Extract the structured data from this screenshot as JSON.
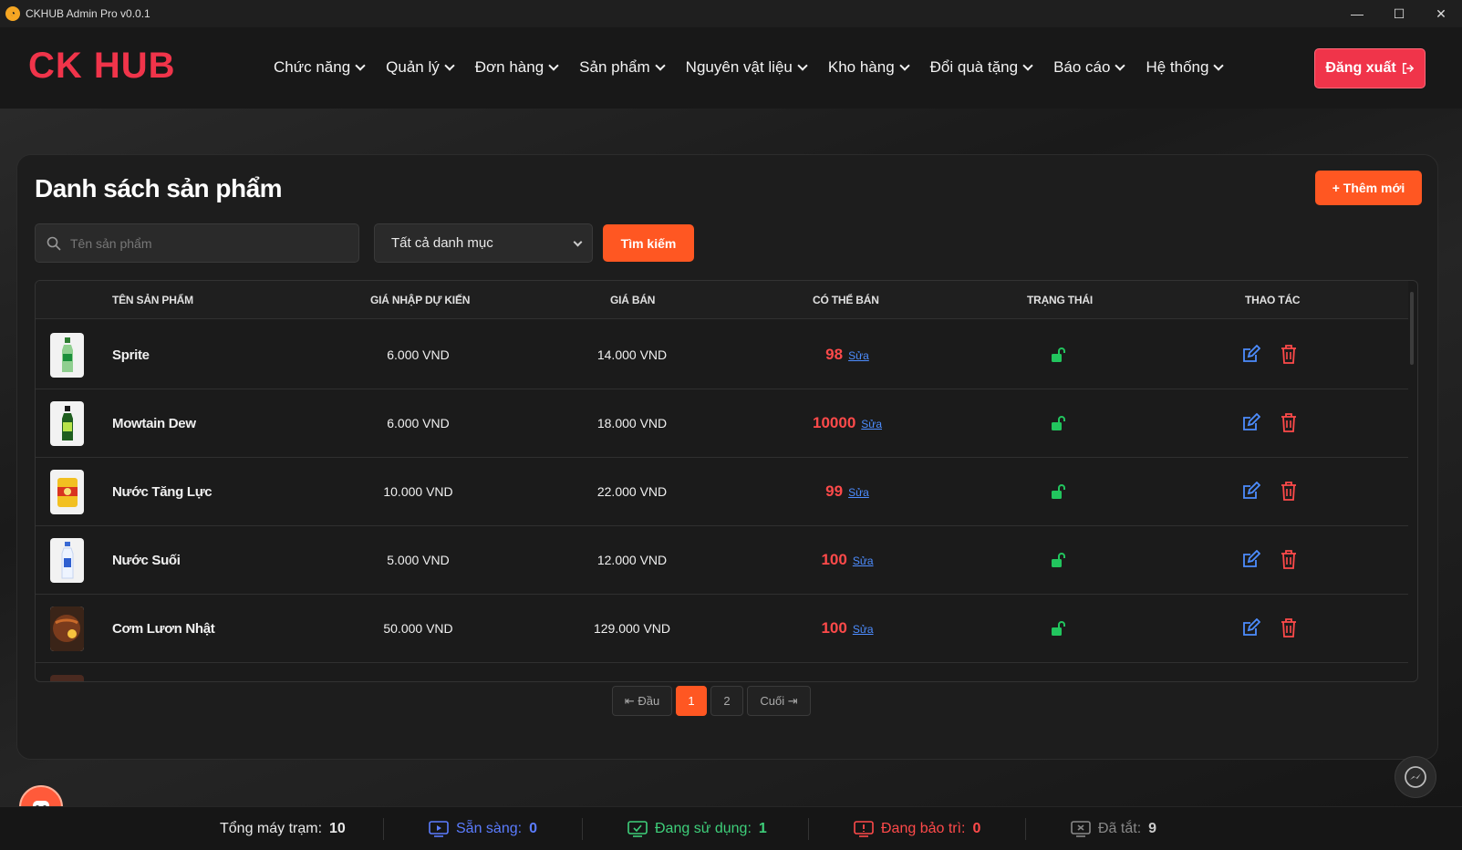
{
  "window": {
    "title": "CKHUB Admin Pro v0.0.1"
  },
  "header": {
    "logo": "CK HUB",
    "nav": [
      "Chức năng",
      "Quản lý",
      "Đơn hàng",
      "Sản phẩm",
      "Nguyên vật liệu",
      "Kho hàng",
      "Đổi quà tặng",
      "Báo cáo",
      "Hệ thống"
    ],
    "logout_label": "Đăng xuất"
  },
  "page": {
    "title": "Danh sách sản phẩm",
    "add_label": "+ Thêm mới",
    "search_placeholder": "Tên sản phẩm",
    "category_value": "Tất cả danh mục",
    "search_label": "Tìm kiếm"
  },
  "table": {
    "headers": [
      "TÊN SẢN PHẨM",
      "GIÁ NHẬP DỰ KIẾN",
      "GIÁ BÁN",
      "CÓ THỂ BÁN",
      "TRẠNG THÁI",
      "THAO TÁC"
    ],
    "edit_stock_label": "Sửa",
    "rows": [
      {
        "name": "Sprite",
        "cost": "6.000 VND",
        "price": "14.000 VND",
        "stock": "98",
        "thumb": "bottle-green"
      },
      {
        "name": "Mowtain Dew",
        "cost": "6.000 VND",
        "price": "18.000 VND",
        "stock": "10000",
        "thumb": "bottle-dew"
      },
      {
        "name": "Nước Tăng Lực",
        "cost": "10.000 VND",
        "price": "22.000 VND",
        "stock": "99",
        "thumb": "can-yellow"
      },
      {
        "name": "Nước Suối",
        "cost": "5.000 VND",
        "price": "12.000 VND",
        "stock": "100",
        "thumb": "bottle-water"
      },
      {
        "name": "Cơm Lươn Nhật",
        "cost": "50.000 VND",
        "price": "129.000 VND",
        "stock": "100",
        "thumb": "rice-bowl"
      }
    ]
  },
  "pagination": {
    "first": "Đầu",
    "pages": [
      "1",
      "2"
    ],
    "active": "1",
    "last": "Cuối"
  },
  "statusbar": {
    "total_label": "Tổng máy trạm:",
    "total": "10",
    "ready_label": "Sẵn sàng:",
    "ready": "0",
    "inuse_label": "Đang sử dụng:",
    "inuse": "1",
    "maint_label": "Đang bảo trì:",
    "maint": "0",
    "off_label": "Đã tắt:",
    "off": "9"
  },
  "colors": {
    "accent": "#ff5722",
    "brand": "#f0344a",
    "ready": "#5b7cff",
    "inuse": "#3ecf7a",
    "maint": "#ff4a4a",
    "off": "#888888"
  }
}
